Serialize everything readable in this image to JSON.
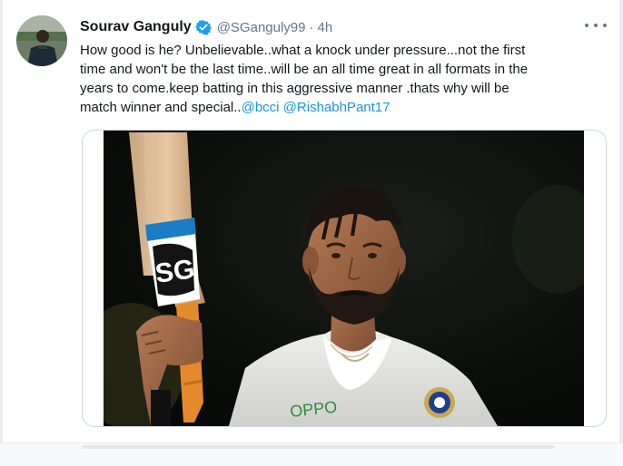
{
  "tweet": {
    "display_name": "Sourav Ganguly",
    "handle": "@SGanguly99",
    "separator": "·",
    "time": "4h",
    "text_lines": [
      "How good is he? Unbelievable..what a knock under pressure...not the first",
      "time and won't be the last time..will be an all time great in all formats in the",
      "years to come.keep batting in this aggressive manner .thats why will be",
      "match winner and special.."
    ],
    "mentions": [
      "@bcci",
      "@RishabhPant17"
    ],
    "verified": true,
    "bat_logo_text": "SG",
    "shirt_brand": "OPPO"
  },
  "icons": {
    "verified": "verified-badge-icon",
    "more": "more-options-icon"
  },
  "colors": {
    "link": "#1b95e0",
    "text": "#14171a",
    "muted": "#657786",
    "verified": "#1da1f2",
    "border": "#ccd6dd"
  }
}
